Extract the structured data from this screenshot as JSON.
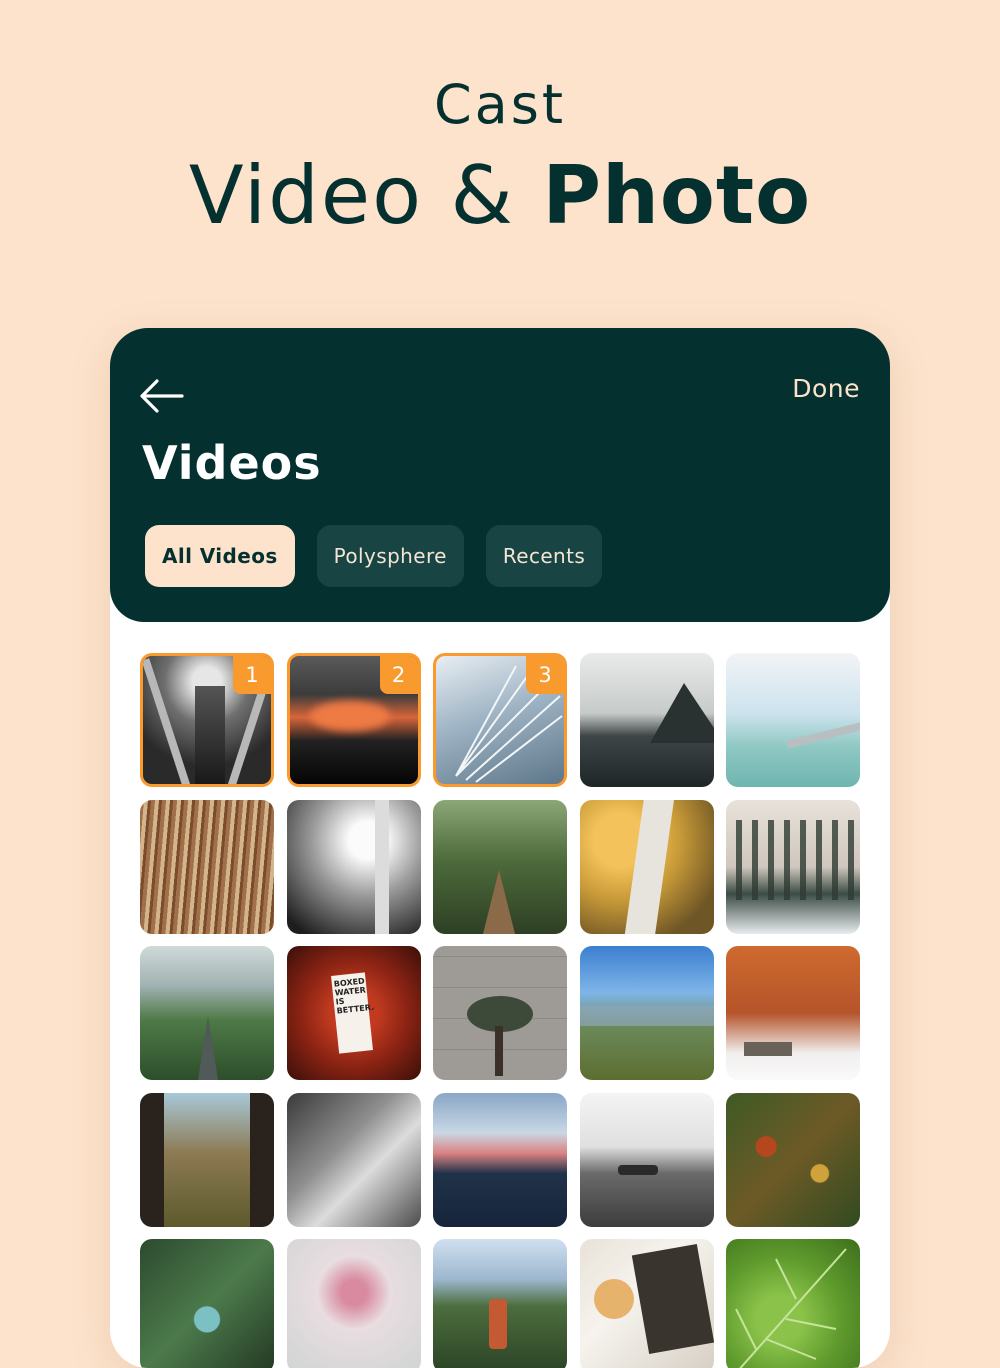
{
  "promo": {
    "line1": "Cast",
    "line2_light": "Video & ",
    "line2_bold": "Photo"
  },
  "header": {
    "back_icon": "arrow-left-icon",
    "done_label": "Done",
    "title": "Videos"
  },
  "tabs": [
    {
      "label": "All Videos",
      "active": true
    },
    {
      "label": "Polysphere",
      "active": false
    },
    {
      "label": "Recents",
      "active": false
    }
  ],
  "thumbnails": [
    {
      "scene": "escalator-tunnel",
      "badge": "1"
    },
    {
      "scene": "sunset-cloud",
      "badge": "2"
    },
    {
      "scene": "glass-building",
      "badge": "3"
    },
    {
      "scene": "fjord-mountain"
    },
    {
      "scene": "sea-bridge"
    },
    {
      "scene": "dry-reeds"
    },
    {
      "scene": "bw-forest"
    },
    {
      "scene": "forest-path"
    },
    {
      "scene": "birch-woodpecker"
    },
    {
      "scene": "snowy-pines"
    },
    {
      "scene": "green-mountain-road"
    },
    {
      "scene": "autumn-leaves-box",
      "text_lines": [
        "BOXED",
        "WATER",
        "IS",
        "BETTER."
      ]
    },
    {
      "scene": "bonsai-wall"
    },
    {
      "scene": "valley-tree"
    },
    {
      "scene": "autumn-tree-bench"
    },
    {
      "scene": "valley-cliff"
    },
    {
      "scene": "bw-lake-coast"
    },
    {
      "scene": "pink-trees-river"
    },
    {
      "scene": "bw-hills"
    },
    {
      "scene": "autumn-forest-aerial"
    },
    {
      "scene": "aerial-lake"
    },
    {
      "scene": "pink-flowers-frame"
    },
    {
      "scene": "pine-valley"
    },
    {
      "scene": "photo-book-flowers"
    },
    {
      "scene": "green-leaf"
    }
  ],
  "colors": {
    "background": "#fde3cc",
    "header": "#04312f",
    "accent": "#f89a2e",
    "tab_inactive": "#184543"
  }
}
